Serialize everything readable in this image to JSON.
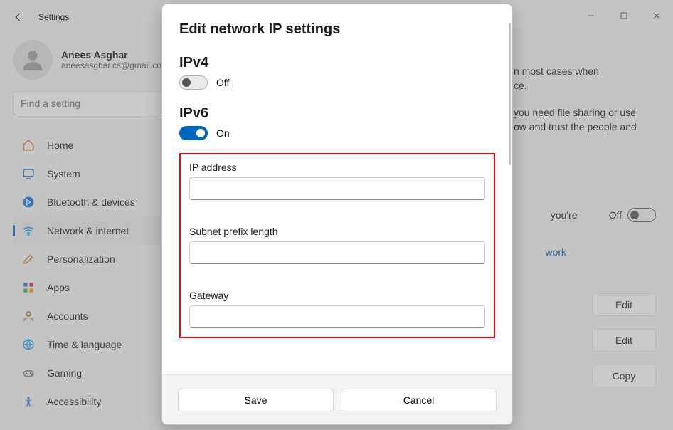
{
  "titlebar": {
    "title": "Settings"
  },
  "user": {
    "name": "Anees Asghar",
    "email": "aneesasghar.cs@gmail.com"
  },
  "sidebar": {
    "search_placeholder": "Find a setting",
    "items": [
      {
        "label": "Home"
      },
      {
        "label": "System"
      },
      {
        "label": "Bluetooth & devices"
      },
      {
        "label": "Network & internet"
      },
      {
        "label": "Personalization"
      },
      {
        "label": "Apps"
      },
      {
        "label": "Accounts"
      },
      {
        "label": "Time & language"
      },
      {
        "label": "Gaming"
      },
      {
        "label": "Accessibility"
      }
    ]
  },
  "right_pane": {
    "snippet_line1_tail": "n most cases   when",
    "snippet_line2_tail": "ce.",
    "snippet_line3": "you need file sharing or use",
    "snippet_line4": "ow and trust the people and",
    "metered_more": "you're",
    "metered_label": "Off",
    "network_link": "work",
    "buttons": {
      "edit": "Edit",
      "copy": "Copy"
    }
  },
  "dialog": {
    "title": "Edit network IP settings",
    "ipv4": {
      "heading": "IPv4",
      "state_label": "Off"
    },
    "ipv6": {
      "heading": "IPv6",
      "state_label": "On"
    },
    "fields": {
      "ip_address": {
        "label": "IP address",
        "value": ""
      },
      "subnet_prefix": {
        "label": "Subnet prefix length",
        "value": ""
      },
      "gateway": {
        "label": "Gateway",
        "value": ""
      }
    },
    "buttons": {
      "save": "Save",
      "cancel": "Cancel"
    }
  }
}
